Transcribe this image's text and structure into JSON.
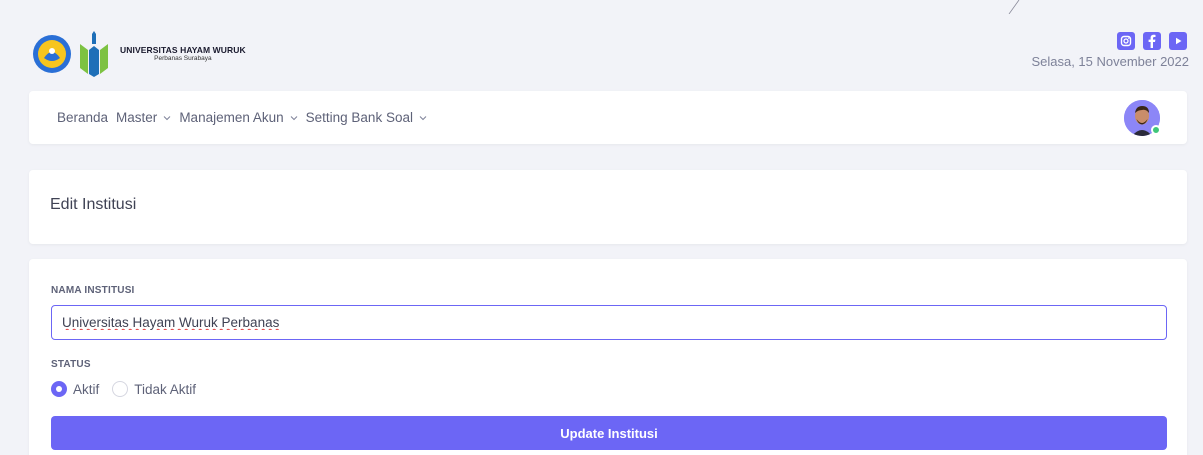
{
  "header": {
    "brand_name": "UNIVERSITAS HAYAM WURUK",
    "brand_sub": "Perbanas Surabaya",
    "date": "Selasa, 15 November 2022",
    "social_icons": [
      "instagram-icon",
      "facebook-icon",
      "youtube-icon"
    ],
    "accent": "#6c66f5"
  },
  "nav": {
    "items": [
      {
        "label": "Beranda",
        "has_dropdown": false
      },
      {
        "label": "Master",
        "has_dropdown": true
      },
      {
        "label": "Manajemen Akun",
        "has_dropdown": true
      },
      {
        "label": "Setting Bank Soal",
        "has_dropdown": true
      }
    ]
  },
  "page": {
    "title": "Edit Institusi"
  },
  "form": {
    "nama_label": "NAMA INSTITUSI",
    "nama_value": "Universitas Hayam Wuruk Perbanas",
    "status_label": "STATUS",
    "status_options": [
      "Aktif",
      "Tidak Aktif"
    ],
    "status_selected": "Aktif",
    "submit_label": "Update Institusi"
  }
}
